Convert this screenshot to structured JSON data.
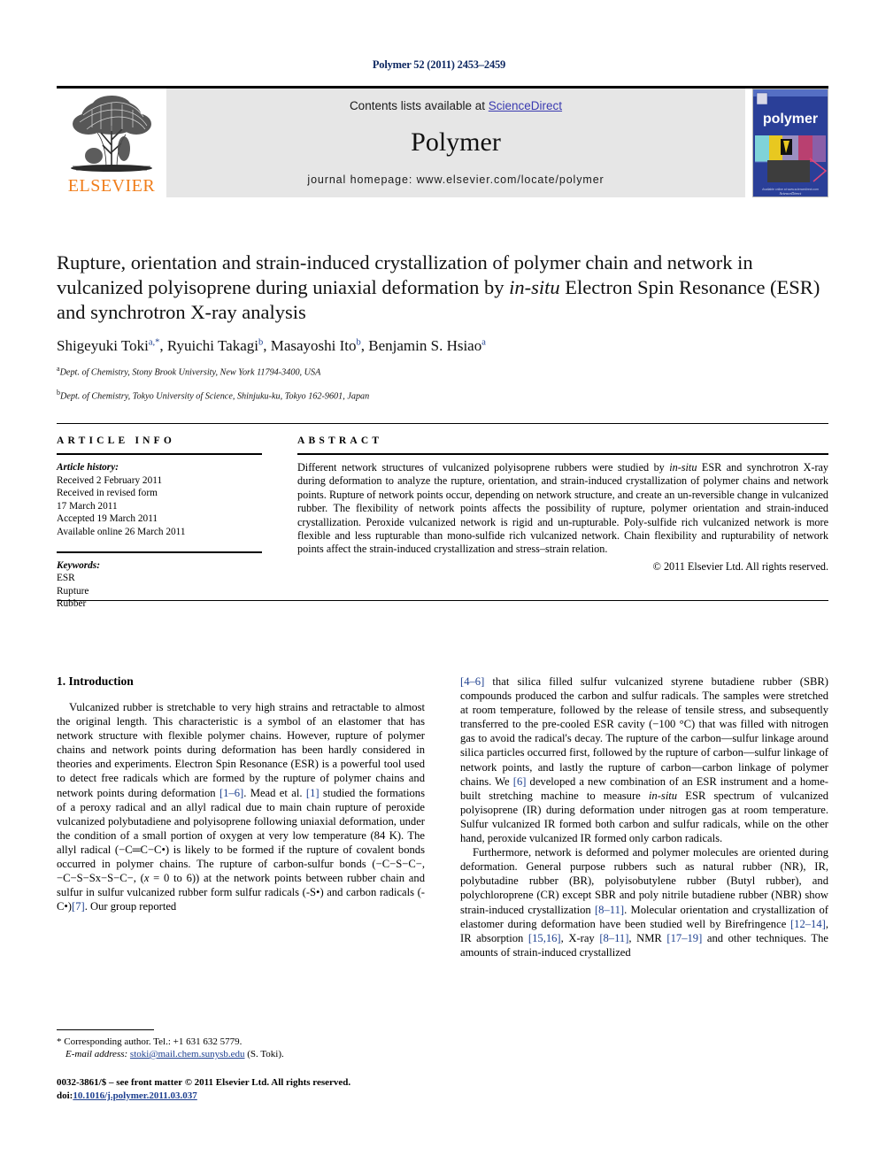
{
  "running_head": "Polymer 52 (2011) 2453–2459",
  "masthead": {
    "contents_prefix": "Contents lists available at ",
    "sciencedirect_link": "ScienceDirect",
    "journal_name": "Polymer",
    "homepage_label": "journal homepage: www.elsevier.com/locate/polymer",
    "publisher_wordmark": "ELSEVIER",
    "cover_wordmark": "polymer",
    "link_color": "#3a3ab0",
    "banner_bg": "#e6e6e6",
    "elsevier_orange": "#f07d1a",
    "cover_blue": "#2a3f98"
  },
  "title": {
    "line1": "Rupture, orientation and strain-induced crystallization of polymer chain and",
    "line2_a": "network in vulcanized polyisoprene during uniaxial deformation by ",
    "line2_italic": "in-situ",
    "line3": "Electron Spin Resonance (ESR) and synchrotron X-ray analysis"
  },
  "authors": [
    {
      "name": "Shigeyuki Toki",
      "marks": "a,*"
    },
    {
      "name": "Ryuichi Takagi",
      "marks": "b"
    },
    {
      "name": "Masayoshi Ito",
      "marks": "b"
    },
    {
      "name": "Benjamin S. Hsiao",
      "marks": "a"
    }
  ],
  "affiliations": [
    {
      "mark": "a",
      "text": "Dept. of Chemistry, Stony Brook University, New York 11794-3400, USA"
    },
    {
      "mark": "b",
      "text": "Dept. of Chemistry, Tokyo University of Science, Shinjuku-ku, Tokyo 162-9601, Japan"
    }
  ],
  "article_info": {
    "heading": "ARTICLE INFO",
    "history_label": "Article history:",
    "history": [
      "Received 2 February 2011",
      "Received in revised form",
      "17 March 2011",
      "Accepted 19 March 2011",
      "Available online 26 March 2011"
    ],
    "keywords_label": "Keywords:",
    "keywords": [
      "ESR",
      "Rupture",
      "Rubber"
    ]
  },
  "abstract": {
    "heading": "ABSTRACT",
    "text_1": "Different network structures of vulcanized polyisoprene rubbers were studied by ",
    "text_italic": "in-situ",
    "text_2": " ESR and synchrotron X-ray during deformation to analyze the rupture, orientation, and strain-induced crystallization of polymer chains and network points. Rupture of network points occur, depending on network structure, and create an un-reversible change in vulcanized rubber. The flexibility of network points affects the possibility of rupture, polymer orientation and strain-induced crystallization. Peroxide vulcanized network is rigid and un-rupturable. Poly-sulfide rich vulcanized network is more flexible and less rupturable than mono-sulfide rich vulcanized network. Chain flexibility and rupturability of network points affect the strain-induced crystallization and stress–strain relation.",
    "copyright": "© 2011 Elsevier Ltd. All rights reserved."
  },
  "section": {
    "intro_heading": "1. Introduction"
  },
  "left_column": {
    "para1_part1": "Vulcanized rubber is stretchable to very high strains and retractable to almost the original length. This characteristic is a symbol of an elastomer that has network structure with flexible polymer chains. However, rupture of polymer chains and network points during deformation has been hardly considered in theories and experiments. Electron Spin Resonance (ESR) is a powerful tool used to detect free radicals which are formed by the rupture of polymer chains and network points during deformation ",
    "ref_1_6": "[1–6]",
    "para1_part2": ". Mead et al. ",
    "ref_1": "[1]",
    "para1_part3": " studied the formations of a peroxy radical and an allyl radical due to main chain rupture of peroxide vulcanized polybutadiene and polyisoprene following uniaxial deformation, under the condition of a small portion of oxygen at very low temperature (84 K). The allyl radical (−C═C−C•) is likely to be formed if the rupture of covalent bonds occurred in polymer chains. The rupture of carbon-sulfur bonds (−C−S−C−, −C−S−Sx−S−C−, (",
    "para1_italic_x": "x",
    "para1_part4": " = 0 to 6)) at the network points between rubber chain and sulfur in sulfur vulcanized rubber form sulfur radicals (-S•) and carbon radicals (-C•)",
    "ref_7": "[7]",
    "para1_part5": ". Our group reported"
  },
  "right_column": {
    "ref_4_6": "[4–6]",
    "para1_part1": " that silica filled sulfur vulcanized styrene butadiene rubber (SBR) compounds produced the carbon and sulfur radicals. The samples were stretched at room temperature, followed by the release of tensile stress, and subsequently transferred to the pre-cooled ESR cavity (−100 °C) that was filled with nitrogen gas to avoid the radical's decay. The rupture of the carbon—sulfur linkage around silica particles occurred first, followed by the rupture of carbon—sulfur linkage of network points, and lastly the rupture of carbon—carbon linkage of polymer chains. We ",
    "ref_6": "[6]",
    "para1_part2": " developed a new combination of an ESR instrument and a home-built stretching machine to measure ",
    "para1_italic": "in-situ",
    "para1_part3": " ESR spectrum of vulcanized polyisoprene (IR) during deformation under nitrogen gas at room temperature. Sulfur vulcanized IR formed both carbon and sulfur radicals, while on the other hand, peroxide vulcanized IR formed only carbon radicals.",
    "para2_part1": "Furthermore, network is deformed and polymer molecules are oriented during deformation. General purpose rubbers such as natural rubber (NR), IR, polybutadine rubber (BR), polyisobutylene rubber (Butyl rubber), and polychloroprene (CR) except SBR and poly nitrile butadiene rubber (NBR) show strain-induced crystallization ",
    "ref_8_11": "[8–11]",
    "para2_part2": ". Molecular orientation and crystallization of elastomer during deformation have been studied well by Birefringence ",
    "ref_12_14": "[12–14]",
    "para2_part3": ", IR absorption ",
    "ref_15_16": "[15,16]",
    "para2_part4": ", X-ray ",
    "ref_8_11b": "[8–11]",
    "para2_part5": ", NMR ",
    "ref_17_19": "[17–19]",
    "para2_part6": " and other techniques. The amounts of strain-induced crystallized"
  },
  "footnote": {
    "corresponding": "* Corresponding author. Tel.: +1 631 632 5779.",
    "email_label": "E-mail address:",
    "email": "stoki@mail.chem.sunysb.edu",
    "email_suffix": " (S. Toki)."
  },
  "imprint": {
    "line1": "0032-3861/$ – see front matter © 2011 Elsevier Ltd. All rights reserved.",
    "doi_label": "doi:",
    "doi_value": "10.1016/j.polymer.2011.03.037"
  }
}
